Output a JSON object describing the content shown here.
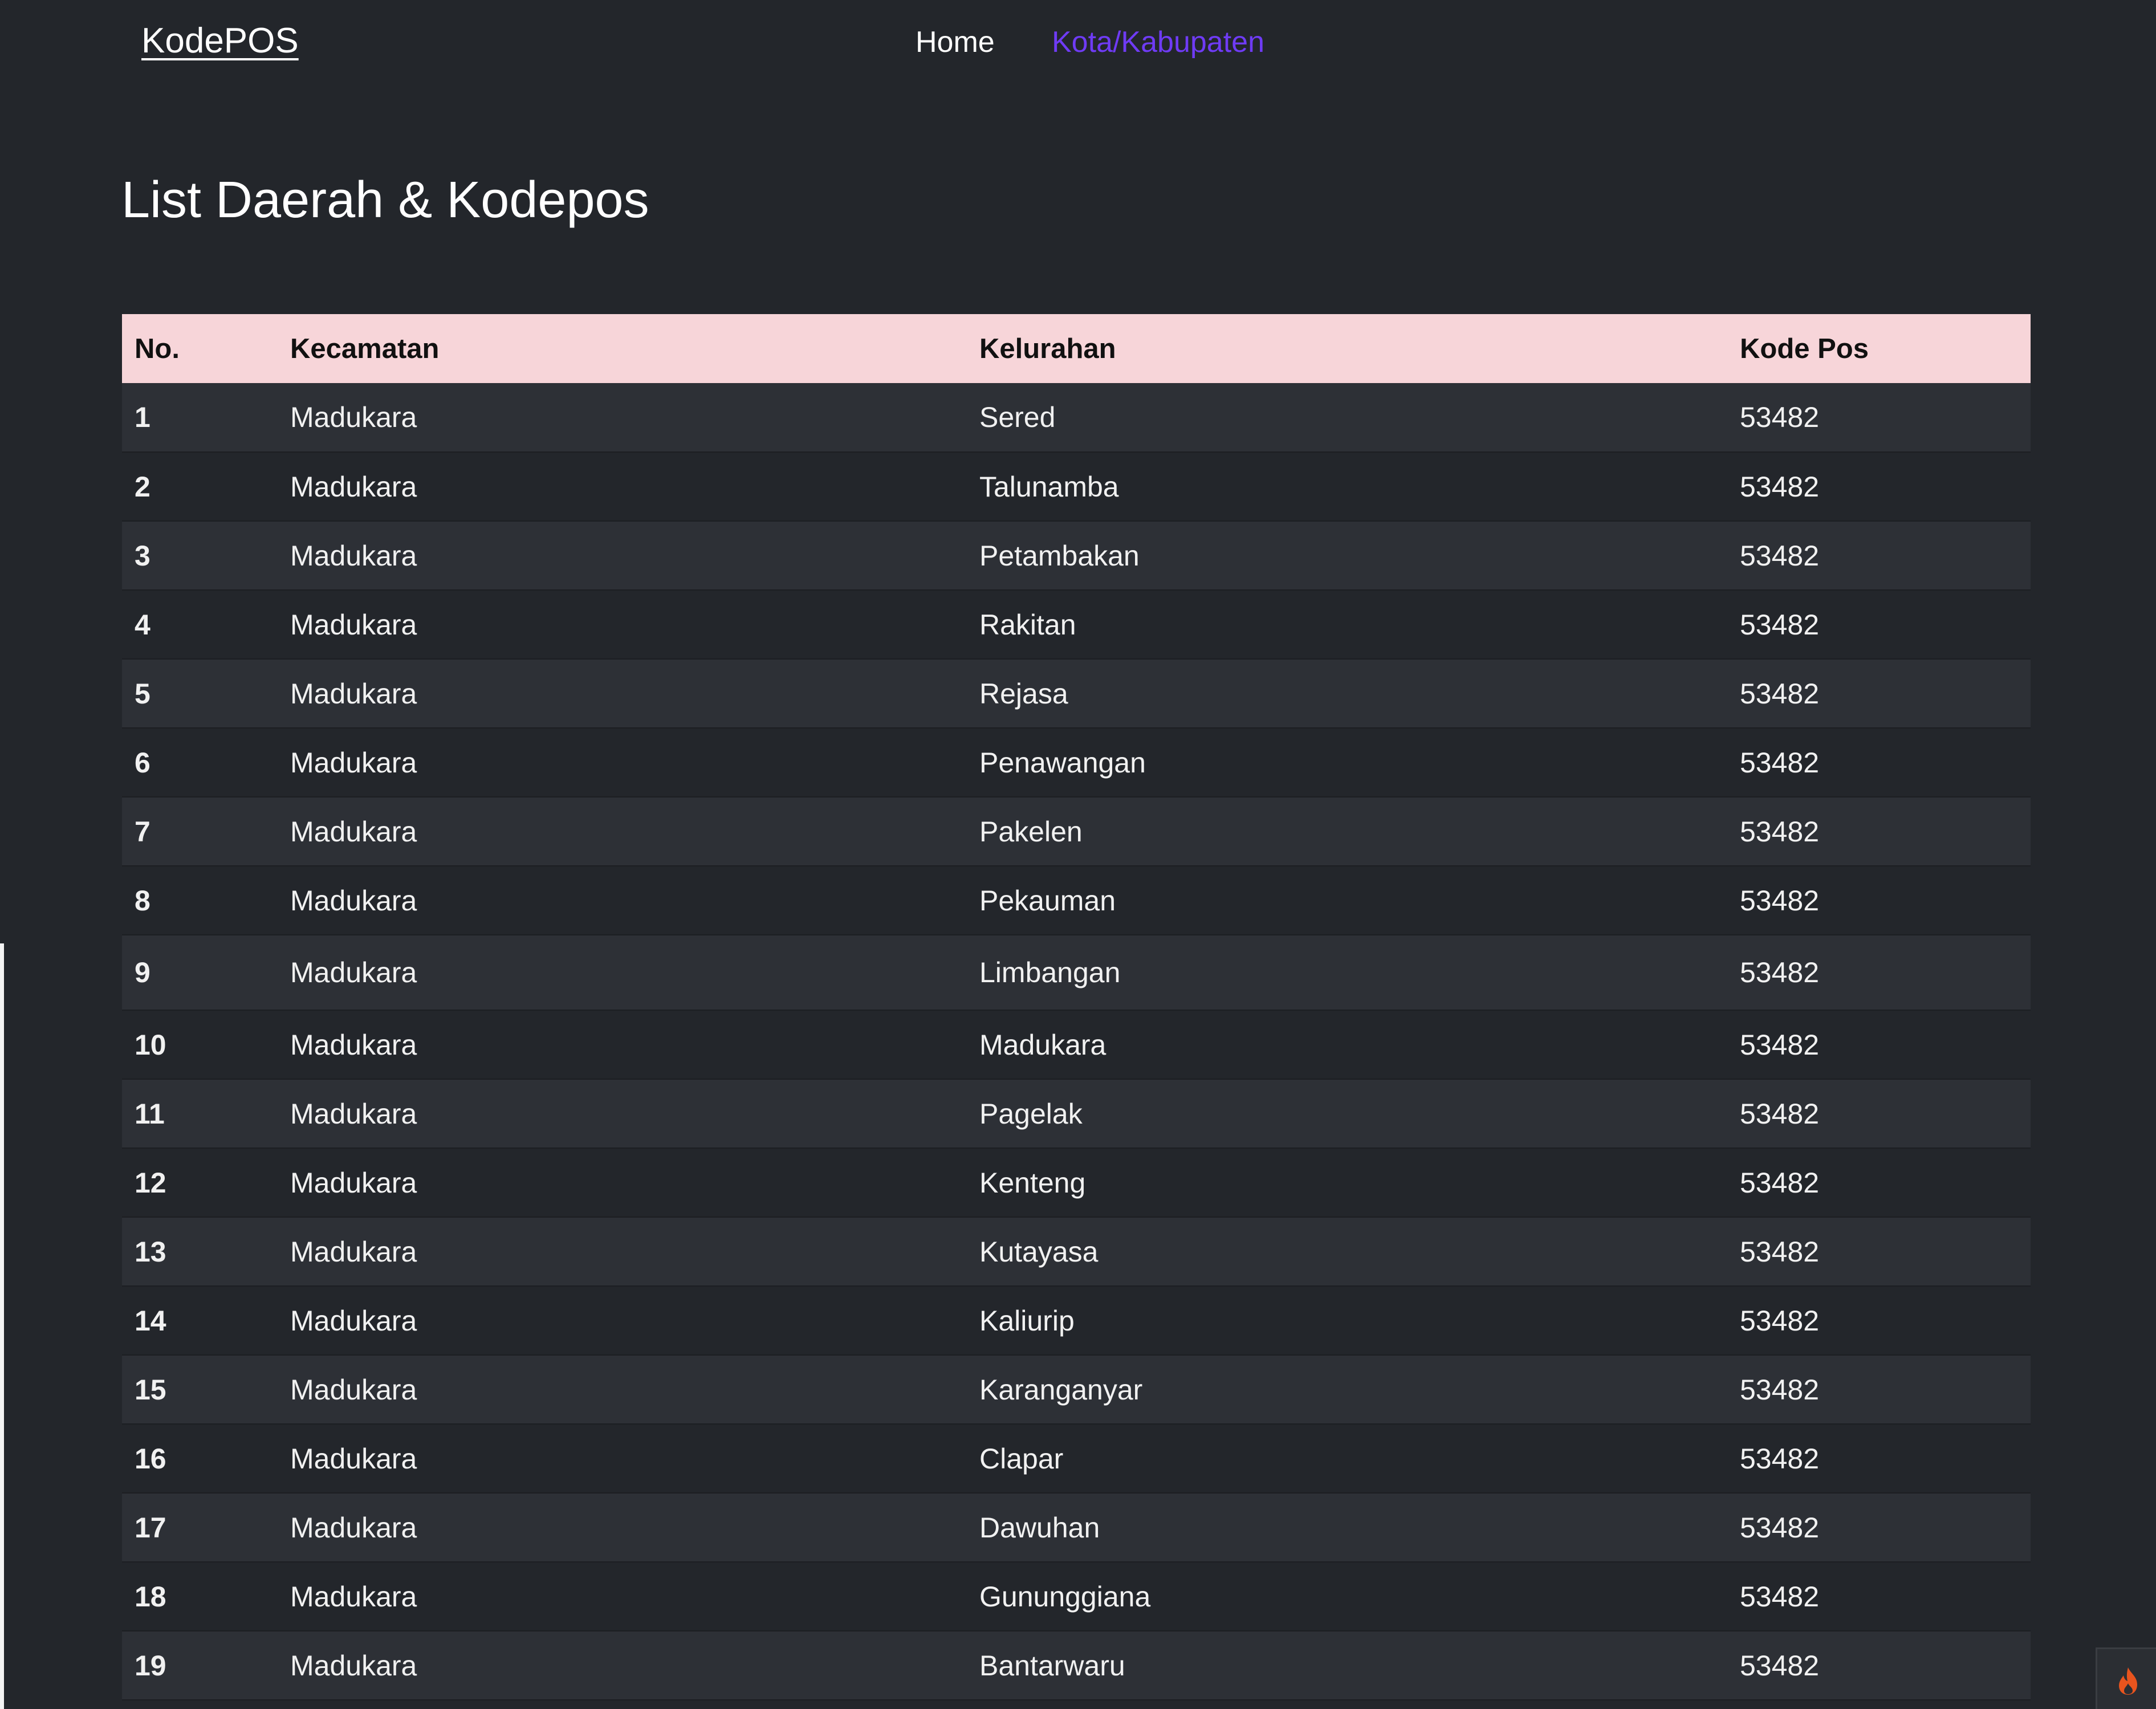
{
  "nav": {
    "brand": "KodePOS",
    "home": "Home",
    "kota": "Kota/Kabupaten"
  },
  "page": {
    "title": "List Daerah & Kodepos"
  },
  "table": {
    "headers": [
      "No.",
      "Kecamatan",
      "Kelurahan",
      "Kode Pos"
    ],
    "rows": [
      [
        "1",
        "Madukara",
        "Sered",
        "53482"
      ],
      [
        "2",
        "Madukara",
        "Talunamba",
        "53482"
      ],
      [
        "3",
        "Madukara",
        "Petambakan",
        "53482"
      ],
      [
        "4",
        "Madukara",
        "Rakitan",
        "53482"
      ],
      [
        "5",
        "Madukara",
        "Rejasa",
        "53482"
      ],
      [
        "6",
        "Madukara",
        "Penawangan",
        "53482"
      ],
      [
        "7",
        "Madukara",
        "Pakelen",
        "53482"
      ],
      [
        "8",
        "Madukara",
        "Pekauman",
        "53482"
      ],
      [
        "9",
        "Madukara",
        "Limbangan",
        "53482"
      ],
      [
        "10",
        "Madukara",
        "Madukara",
        "53482"
      ],
      [
        "11",
        "Madukara",
        "Pagelak",
        "53482"
      ],
      [
        "12",
        "Madukara",
        "Kenteng",
        "53482"
      ],
      [
        "13",
        "Madukara",
        "Kutayasa",
        "53482"
      ],
      [
        "14",
        "Madukara",
        "Kaliurip",
        "53482"
      ],
      [
        "15",
        "Madukara",
        "Karanganyar",
        "53482"
      ],
      [
        "16",
        "Madukara",
        "Clapar",
        "53482"
      ],
      [
        "17",
        "Madukara",
        "Dawuhan",
        "53482"
      ],
      [
        "18",
        "Madukara",
        "Gununggiana",
        "53482"
      ],
      [
        "19",
        "Madukara",
        "Bantarwaru",
        "53482"
      ]
    ]
  },
  "colors": {
    "background": "#23262b",
    "header_row": "#f7d5d9",
    "active_nav": "#6f3bf5",
    "flame": "#e8541e"
  },
  "icons": {
    "corner_widget": "flame-icon"
  }
}
